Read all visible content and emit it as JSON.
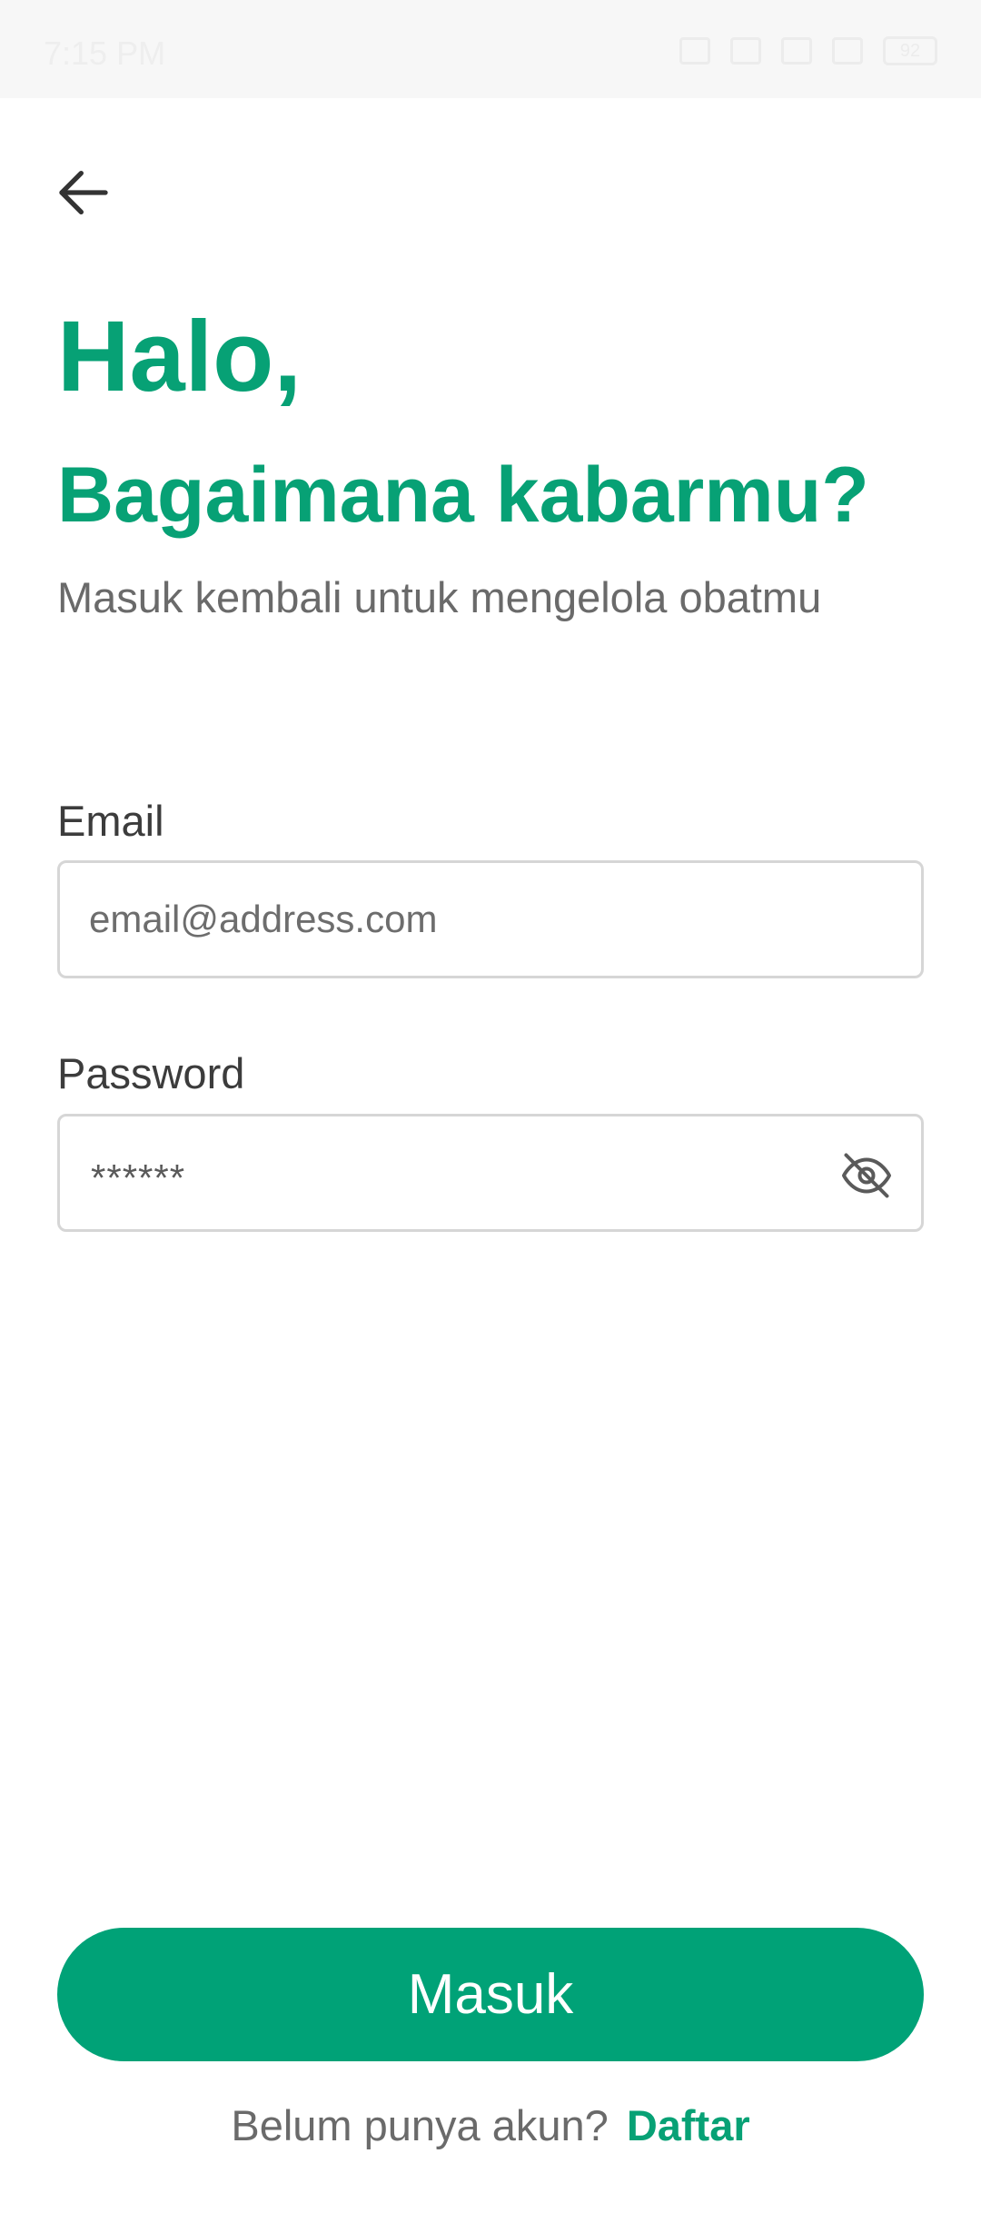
{
  "status_bar": {
    "time": "7:15 PM",
    "battery": "92",
    "icons": [
      "vibrate-icon",
      "data-icon",
      "wifi-icon",
      "signal-icon",
      "signal-icon",
      "battery-icon"
    ]
  },
  "header": {
    "back_icon": "arrow-left-icon"
  },
  "greeting": {
    "title": "Halo,",
    "headline": "Bagaimana kabarmu?",
    "subtitle": "Masuk kembali untuk mengelola obatmu"
  },
  "form": {
    "email": {
      "label": "Email",
      "placeholder": "email@address.com",
      "value": ""
    },
    "password": {
      "label": "Password",
      "value": "******",
      "toggle_icon": "eye-off-icon"
    }
  },
  "actions": {
    "login_label": "Masuk",
    "register_prompt": "Belum punya akun?",
    "register_link": "Daftar"
  },
  "colors": {
    "brand": "#07A175",
    "button": "#00A277",
    "text_dark": "#3C3C3C",
    "text_muted": "#6A6A6A",
    "border": "#D6D6D6"
  }
}
